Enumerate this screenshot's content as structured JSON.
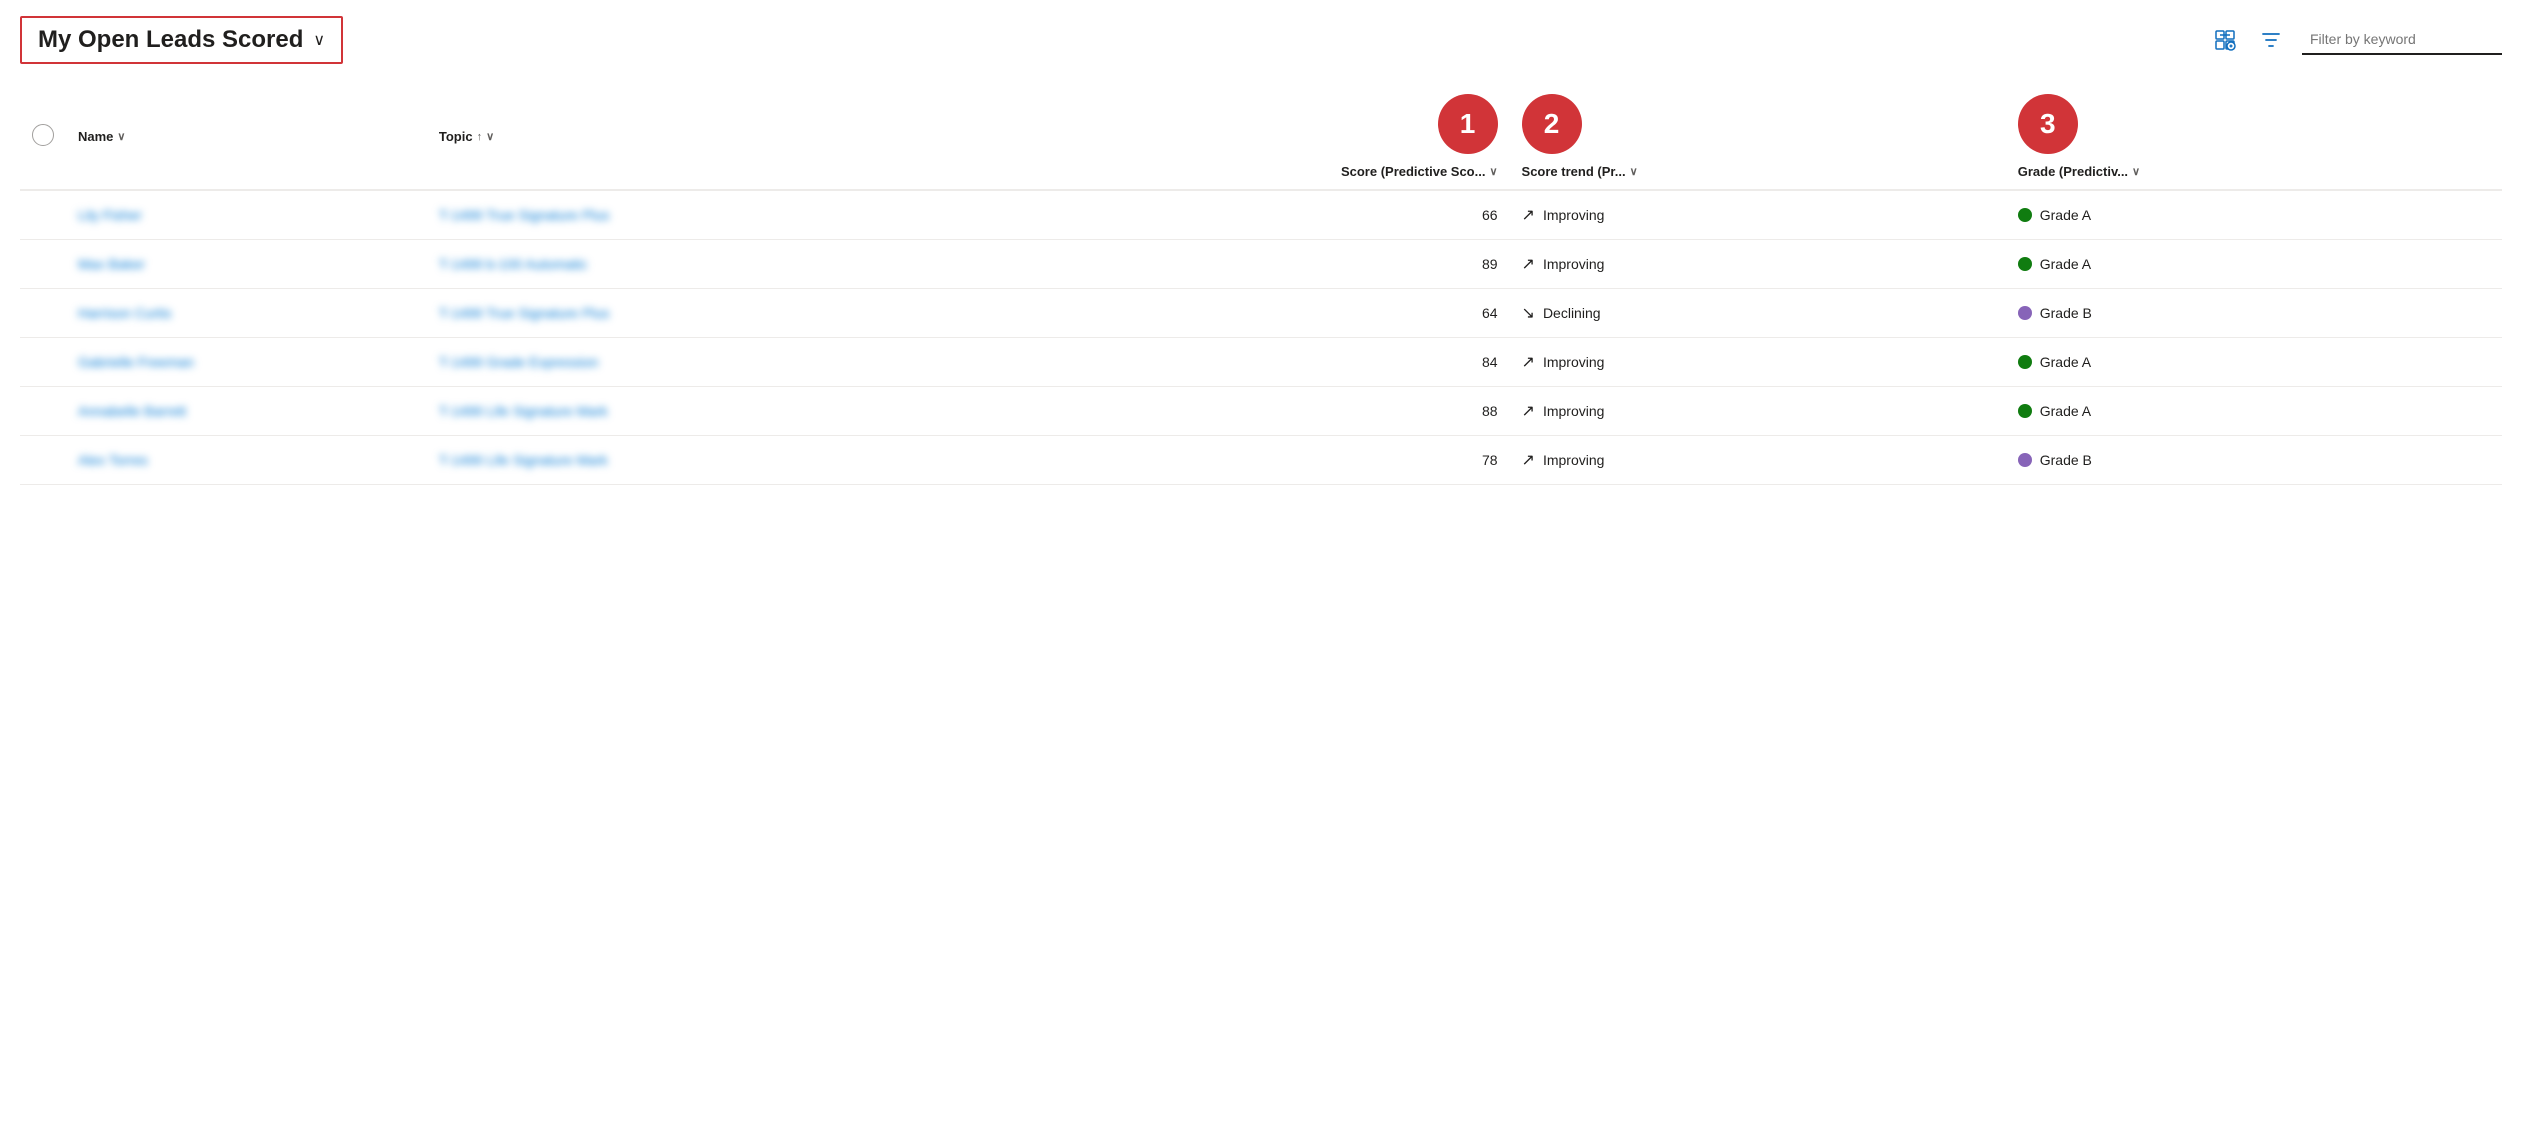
{
  "header": {
    "title": "My Open Leads Scored",
    "title_chevron": "∨",
    "filter_placeholder": "Filter by keyword"
  },
  "toolbar": {
    "view_icon": "⊞",
    "filter_icon": "▽"
  },
  "badges": [
    {
      "id": "badge-1",
      "label": "1"
    },
    {
      "id": "badge-2",
      "label": "2"
    },
    {
      "id": "badge-3",
      "label": "3"
    }
  ],
  "columns": {
    "checkbox": "",
    "name": "Name",
    "name_sort": "∨",
    "topic": "Topic",
    "topic_sort_up": "↑",
    "topic_sort_down": "∨",
    "score": "Score (Predictive Sco...",
    "score_sort": "∨",
    "trend": "Score trend (Pr...",
    "trend_sort": "∨",
    "grade": "Grade (Predictiv...",
    "grade_sort": "∨"
  },
  "rows": [
    {
      "name": "Lily Fisher",
      "topic": "T-1499 True Signature Plus",
      "score": "66",
      "trend_arrow": "↗",
      "trend_label": "Improving",
      "grade_color": "green",
      "grade_label": "Grade A"
    },
    {
      "name": "Max Baker",
      "topic": "T-1499 b-100 Automatic",
      "score": "89",
      "trend_arrow": "↗",
      "trend_label": "Improving",
      "grade_color": "green",
      "grade_label": "Grade A"
    },
    {
      "name": "Harrison Curtis",
      "topic": "T-1499 True Signature Plus",
      "score": "64",
      "trend_arrow": "↘",
      "trend_label": "Declining",
      "grade_color": "purple",
      "grade_label": "Grade B"
    },
    {
      "name": "Gabrielle Freeman",
      "topic": "T-1499 Grade Expression",
      "score": "84",
      "trend_arrow": "↗",
      "trend_label": "Improving",
      "grade_color": "green",
      "grade_label": "Grade A"
    },
    {
      "name": "Annabelle Barrett",
      "topic": "T-1499 Life Signature Mark",
      "score": "88",
      "trend_arrow": "↗",
      "trend_label": "Improving",
      "grade_color": "green",
      "grade_label": "Grade A"
    },
    {
      "name": "Alex Torres",
      "topic": "T-1499 Life Signature Mark",
      "score": "78",
      "trend_arrow": "↗",
      "trend_label": "Improving",
      "grade_color": "purple",
      "grade_label": "Grade B"
    }
  ]
}
